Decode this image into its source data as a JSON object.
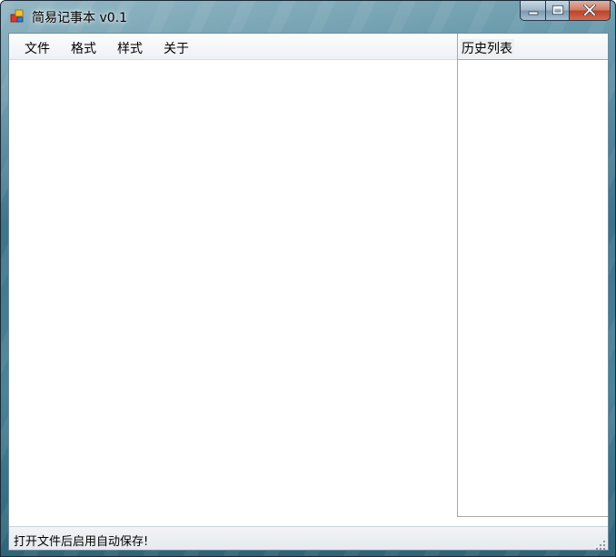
{
  "window": {
    "title": "简易记事本 v0.1"
  },
  "menu": {
    "items": [
      "文件",
      "格式",
      "样式",
      "关于"
    ]
  },
  "editor": {
    "value": ""
  },
  "history": {
    "header": "历史列表",
    "items": []
  },
  "status": {
    "text": "打开文件后启用自动保存!"
  },
  "icons": {
    "app": "app-window-icon",
    "minimize": "minimize-icon",
    "maximize": "maximize-icon",
    "close": "close-icon",
    "grip": "resize-grip-icon"
  }
}
